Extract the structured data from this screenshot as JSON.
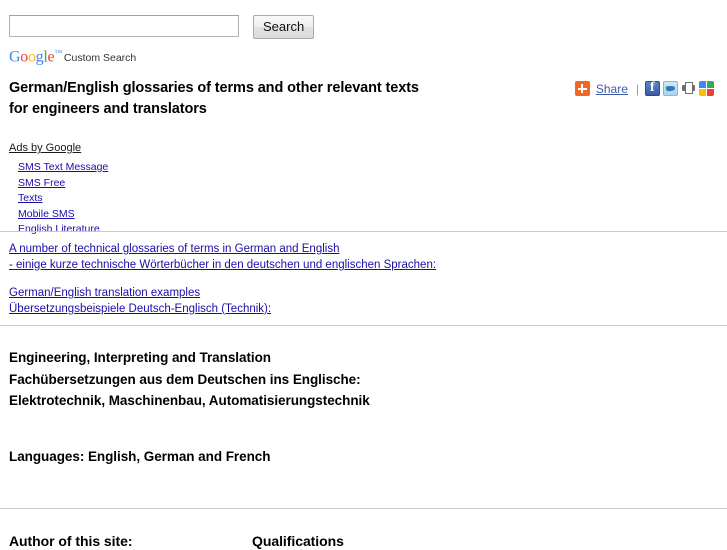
{
  "search": {
    "input_value": "",
    "input_placeholder": "",
    "button_label": "Search",
    "branding": {
      "logo_letters": [
        {
          "char": "G",
          "color": "#4285f4"
        },
        {
          "char": "o",
          "color": "#ea4335"
        },
        {
          "char": "o",
          "color": "#fbbc05"
        },
        {
          "char": "g",
          "color": "#4285f4"
        },
        {
          "char": "l",
          "color": "#34a853"
        },
        {
          "char": "e",
          "color": "#ea4335"
        }
      ],
      "trademark": "™",
      "label": "Custom Search"
    }
  },
  "header": {
    "title_line_1": "German/English glossaries of terms and other relevant texts",
    "title_line_2": "for engineers and translators"
  },
  "share": {
    "plus_icon": "addthis-plus-icon",
    "share_label": "Share",
    "separator": "|",
    "icons": [
      {
        "name": "facebook-icon",
        "label": "Facebook"
      },
      {
        "name": "twitter-icon",
        "label": "Twitter"
      },
      {
        "name": "print-icon",
        "label": "Print"
      },
      {
        "name": "google-share-icon",
        "label": "Google"
      }
    ]
  },
  "ads": {
    "title": "Ads by Google",
    "items": [
      {
        "label": "SMS Text Message",
        "underlined": true
      },
      {
        "label": "SMS Free",
        "underlined": true
      },
      {
        "label": "Texts",
        "underlined": true
      },
      {
        "label": "Mobile SMS",
        "underlined": true
      },
      {
        "label": "English Literature",
        "underlined": false
      }
    ]
  },
  "links": {
    "group_1": [
      "A number of technical glossaries of terms in German and English",
      "- einige kurze technische Wörterbücher in den deutschen und englischen Sprachen:"
    ],
    "group_2": [
      "German/English translation examples",
      "Übersetzungsbeispiele Deutsch-Englisch (Technik):"
    ]
  },
  "services": {
    "line_1": "Engineering, Interpreting and Translation",
    "line_2": "Fachübersetzungen aus dem Deutschen ins Englische:",
    "line_3": "Elektrotechnik, Maschinenbau, Automatisierungstechnik"
  },
  "languages": {
    "text": "Languages: English, German and French"
  },
  "bottom": {
    "column_1_heading": "Author of this site:",
    "column_2_heading": "Qualifications"
  },
  "colors": {
    "link": "#1a0dab",
    "share_link": "#3b5ba5",
    "accent_orange": "#f26522",
    "rule": "#c9c9c9",
    "google_blue": "#4285f4",
    "google_red": "#ea4335",
    "google_yellow": "#fbbc05",
    "google_green": "#34a853"
  }
}
